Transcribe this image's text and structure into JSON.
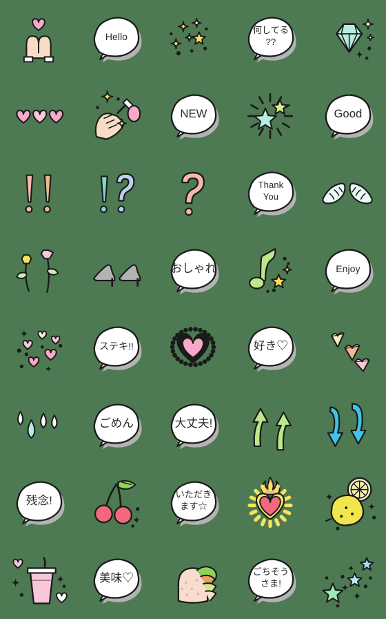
{
  "sheet": {
    "title": "Emoji Sticker Sheet",
    "background_color": "#4d7a52",
    "columns": 5,
    "rows": 8,
    "total_items": 40
  },
  "palette": {
    "background": "#4d7a52",
    "bubble_fill": "#ffffff",
    "bubble_shadow": "#b3b3b3",
    "outline": "#1a1a1a",
    "pink": "#f7a8c4",
    "pink_light": "#f9c6da",
    "pink_heart": "#f6a9c8",
    "skin": "#f8ddc4",
    "yellow": "#f5e45c",
    "yellow_star": "#f6e063",
    "mint": "#b9ece0",
    "green_light": "#bde88a",
    "blue": "#3fc3e8",
    "blue_light": "#bcd2f0",
    "peach": "#f5b9ad",
    "orange_light": "#efb98f",
    "red": "#f2687f",
    "lemon": "#f2e64e",
    "cyan": "#7fd9d1"
  },
  "items": [
    {
      "index": 1,
      "row": 1,
      "col": 1,
      "icon": "heart-hands-icon",
      "label": "heart hands",
      "text": ""
    },
    {
      "index": 2,
      "row": 1,
      "col": 2,
      "icon": "speech-bubble-icon",
      "label": "Hello bubble",
      "text": "Hello"
    },
    {
      "index": 3,
      "row": 1,
      "col": 3,
      "icon": "sparkle-stars-icon",
      "label": "sparkling stars",
      "text": ""
    },
    {
      "index": 4,
      "row": 1,
      "col": 4,
      "icon": "speech-bubble-icon",
      "label": "what are you doing bubble",
      "text": "何してる",
      "text2": "??"
    },
    {
      "index": 5,
      "row": 1,
      "col": 5,
      "icon": "diamond-icon",
      "label": "diamond gem",
      "text": ""
    },
    {
      "index": 6,
      "row": 2,
      "col": 1,
      "icon": "three-hearts-icon",
      "label": "three pink hearts",
      "text": ""
    },
    {
      "index": 7,
      "row": 2,
      "col": 2,
      "icon": "manicure-hand-icon",
      "label": "nail polish hand",
      "text": ""
    },
    {
      "index": 8,
      "row": 2,
      "col": 3,
      "icon": "speech-bubble-icon",
      "label": "NEW bubble",
      "text": "NEW"
    },
    {
      "index": 9,
      "row": 2,
      "col": 4,
      "icon": "shining-star-icon",
      "label": "shining stars",
      "text": ""
    },
    {
      "index": 10,
      "row": 2,
      "col": 5,
      "icon": "speech-bubble-icon",
      "label": "Good bubble",
      "text": "Good"
    },
    {
      "index": 11,
      "row": 3,
      "col": 1,
      "icon": "double-exclamation-icon",
      "label": "double exclamation",
      "text": "!!"
    },
    {
      "index": 12,
      "row": 3,
      "col": 2,
      "icon": "interrobang-icon",
      "label": "exclamation question",
      "text": "!?"
    },
    {
      "index": 13,
      "row": 3,
      "col": 3,
      "icon": "question-mark-icon",
      "label": "question mark",
      "text": "?"
    },
    {
      "index": 14,
      "row": 3,
      "col": 4,
      "icon": "speech-bubble-icon",
      "label": "Thank You bubble",
      "text": "Thank",
      "text2": "You"
    },
    {
      "index": 15,
      "row": 3,
      "col": 5,
      "icon": "angel-wings-icon",
      "label": "angel wings",
      "text": ""
    },
    {
      "index": 16,
      "row": 4,
      "col": 1,
      "icon": "flowers-icon",
      "label": "two flowers",
      "text": ""
    },
    {
      "index": 17,
      "row": 4,
      "col": 2,
      "icon": "high-heels-icon",
      "label": "high heel shoes",
      "text": ""
    },
    {
      "index": 18,
      "row": 4,
      "col": 3,
      "icon": "speech-bubble-icon",
      "label": "stylish bubble",
      "text": "おしゃれ"
    },
    {
      "index": 19,
      "row": 4,
      "col": 4,
      "icon": "music-note-icon",
      "label": "music note sparkle",
      "text": ""
    },
    {
      "index": 20,
      "row": 4,
      "col": 5,
      "icon": "speech-bubble-icon",
      "label": "Enjoy bubble",
      "text": "Enjoy"
    },
    {
      "index": 21,
      "row": 5,
      "col": 1,
      "icon": "hearts-burst-icon",
      "label": "hearts burst",
      "text": ""
    },
    {
      "index": 22,
      "row": 5,
      "col": 2,
      "icon": "speech-bubble-icon",
      "label": "wonderful bubble",
      "text": "ステキ!!"
    },
    {
      "index": 23,
      "row": 5,
      "col": 3,
      "icon": "lace-heart-icon",
      "label": "lace frame heart",
      "text": ""
    },
    {
      "index": 24,
      "row": 5,
      "col": 4,
      "icon": "speech-bubble-icon",
      "label": "like bubble",
      "text": "好き♡"
    },
    {
      "index": 25,
      "row": 5,
      "col": 5,
      "icon": "falling-hearts-icon",
      "label": "falling hearts",
      "text": ""
    },
    {
      "index": 26,
      "row": 6,
      "col": 1,
      "icon": "sweat-drops-icon",
      "label": "sweat drops",
      "text": ""
    },
    {
      "index": 27,
      "row": 6,
      "col": 2,
      "icon": "speech-bubble-icon",
      "label": "sorry bubble",
      "text": "ごめん"
    },
    {
      "index": 28,
      "row": 6,
      "col": 3,
      "icon": "speech-bubble-icon",
      "label": "its okay bubble",
      "text": "大丈夫!"
    },
    {
      "index": 29,
      "row": 6,
      "col": 4,
      "icon": "up-arrows-icon",
      "label": "green up arrows",
      "text": ""
    },
    {
      "index": 30,
      "row": 6,
      "col": 5,
      "icon": "down-arrows-icon",
      "label": "blue down arrows",
      "text": ""
    },
    {
      "index": 31,
      "row": 7,
      "col": 1,
      "icon": "speech-bubble-icon",
      "label": "too bad bubble",
      "text": "残念!"
    },
    {
      "index": 32,
      "row": 7,
      "col": 2,
      "icon": "cherries-icon",
      "label": "cherries",
      "text": ""
    },
    {
      "index": 33,
      "row": 7,
      "col": 3,
      "icon": "speech-bubble-icon",
      "label": "lets eat bubble",
      "text": "いただき",
      "text2": "ます☆"
    },
    {
      "index": 34,
      "row": 7,
      "col": 4,
      "icon": "flaming-heart-icon",
      "label": "flaming heart",
      "text": ""
    },
    {
      "index": 35,
      "row": 7,
      "col": 5,
      "icon": "lemon-icon",
      "label": "lemon with slice",
      "text": ""
    },
    {
      "index": 36,
      "row": 8,
      "col": 1,
      "icon": "drink-cup-icon",
      "label": "pink drink cup",
      "text": ""
    },
    {
      "index": 37,
      "row": 8,
      "col": 2,
      "icon": "speech-bubble-icon",
      "label": "delicious bubble",
      "text": "美味♡"
    },
    {
      "index": 38,
      "row": 8,
      "col": 3,
      "icon": "sandwich-icon",
      "label": "sandwich",
      "text": ""
    },
    {
      "index": 39,
      "row": 8,
      "col": 4,
      "icon": "speech-bubble-icon",
      "label": "thanks for meal bubble",
      "text": "ごちそう",
      "text2": "さま!"
    },
    {
      "index": 40,
      "row": 8,
      "col": 5,
      "icon": "stars-cluster-icon",
      "label": "star cluster",
      "text": ""
    }
  ]
}
